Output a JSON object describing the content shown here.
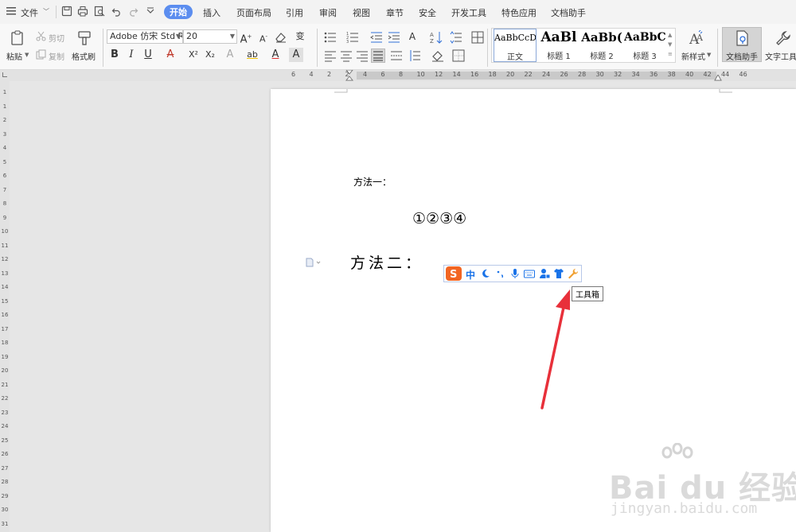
{
  "menu": {
    "file_label": "文件",
    "tabs": [
      "开始",
      "插入",
      "页面布局",
      "引用",
      "审阅",
      "视图",
      "章节",
      "安全",
      "开发工具",
      "特色应用",
      "文档助手"
    ],
    "active_tab": "开始"
  },
  "ribbon": {
    "paste_label": "粘贴",
    "cut_label": "剪切",
    "copy_label": "复制",
    "format_painter_label": "格式刷",
    "font_name": "Adobe 仿宋 Std R",
    "font_size": "20",
    "styles": [
      {
        "preview": "AaBbCcDd",
        "name": "正文"
      },
      {
        "preview": "AaBl",
        "name": "标题 1"
      },
      {
        "preview": "AaBb(",
        "name": "标题 2"
      },
      {
        "preview": "AaBbC",
        "name": "标题 3"
      }
    ],
    "new_style_label": "新样式",
    "doc_assistant_label": "文档助手",
    "text_tools_label": "文字工具"
  },
  "ruler": {
    "h_ticks": [
      "6",
      "4",
      "2",
      "2",
      "4",
      "6",
      "8",
      "10",
      "12",
      "14",
      "16",
      "18",
      "20",
      "22",
      "24",
      "26",
      "28",
      "30",
      "32",
      "34",
      "36",
      "38",
      "40",
      "42",
      "44",
      "46"
    ],
    "v_ticks": [
      "1",
      "1",
      "2",
      "3",
      "4",
      "5",
      "6",
      "7",
      "8",
      "9",
      "10",
      "11",
      "12",
      "13",
      "14",
      "15",
      "16",
      "17",
      "18",
      "19",
      "20",
      "21",
      "22",
      "23",
      "24",
      "25",
      "26",
      "27",
      "28",
      "29",
      "30",
      "31"
    ]
  },
  "document": {
    "method1": "方法一：",
    "circled_numbers": "①②③④",
    "method2": "方法二："
  },
  "ime": {
    "lang_label": "中",
    "toolbox_tooltip": "工具箱"
  },
  "watermark": {
    "brand": "Bai du 经验",
    "url": "jingyan.baidu.com"
  },
  "colors": {
    "accent": "#5b8def",
    "arrow": "#e8303a",
    "ime_logo": "#f26522",
    "ime_blue": "#1a73e8"
  }
}
